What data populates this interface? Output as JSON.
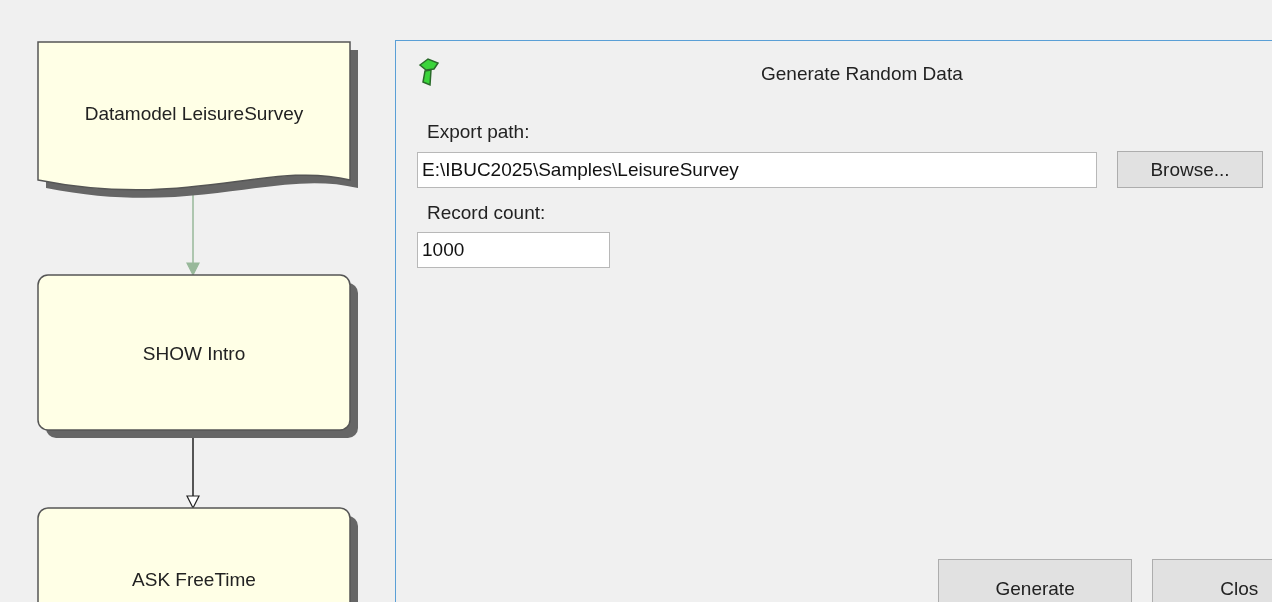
{
  "flowchart": {
    "nodes": [
      {
        "kind": "document",
        "label": "Datamodel LeisureSurvey"
      },
      {
        "kind": "process",
        "label": "SHOW Intro"
      },
      {
        "kind": "process",
        "label": "ASK FreeTime"
      }
    ],
    "connectors": [
      {
        "kind": "data"
      },
      {
        "kind": "flow"
      }
    ]
  },
  "dialog": {
    "title": "Generate Random Data",
    "fields": [
      {
        "label": "Export path:",
        "value": "E:\\IBUC2025\\Samples\\LeisureSurvey",
        "button": "Browse..."
      },
      {
        "label": "Record count:",
        "value": "1000"
      }
    ],
    "buttons": [
      "Generate",
      "Clos"
    ]
  }
}
